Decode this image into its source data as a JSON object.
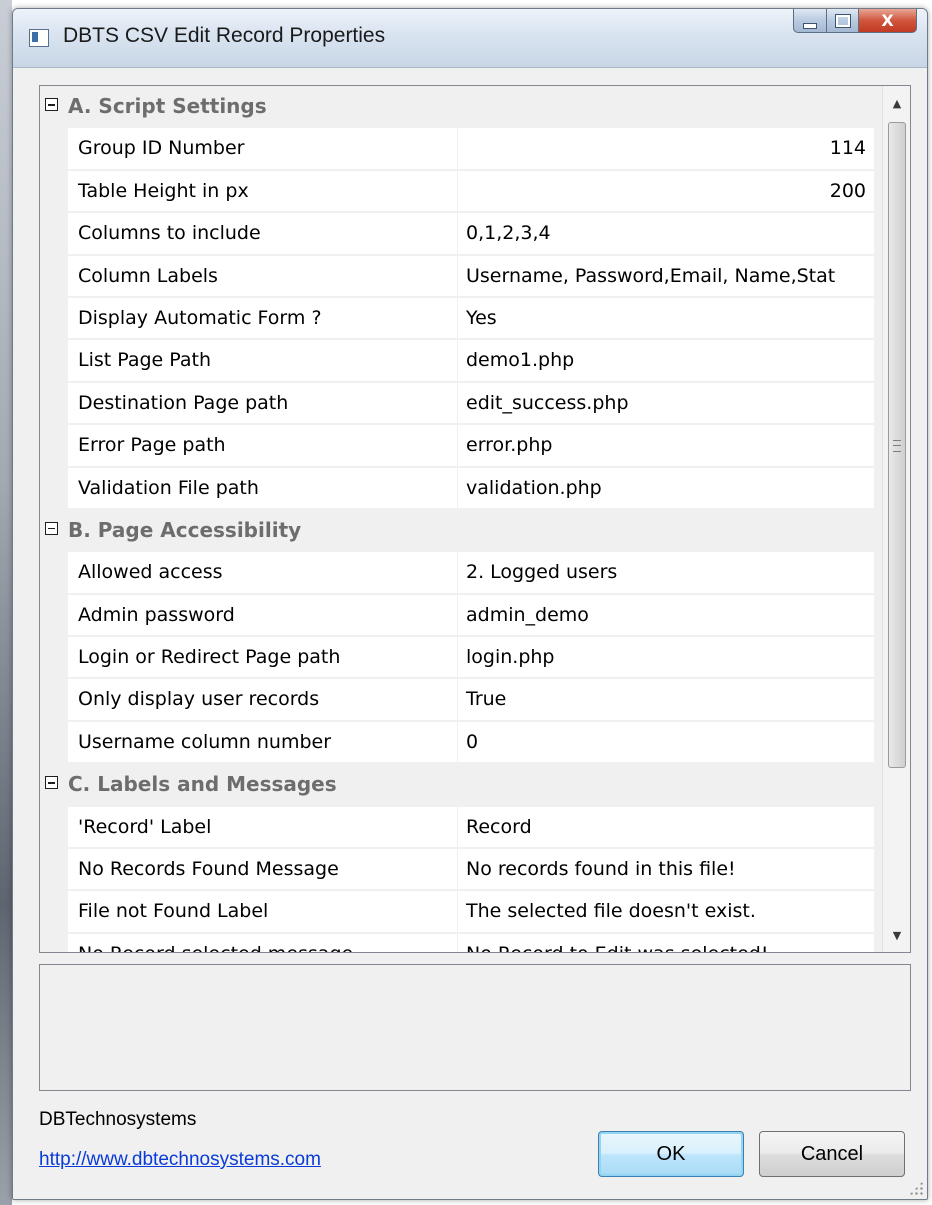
{
  "window": {
    "title": "DBTS CSV Edit Record Properties"
  },
  "icons": {
    "app": "app-window-icon",
    "minimize": "minimize-icon",
    "maximize": "maximize-icon",
    "close": "close-icon",
    "expander": "collapse-minus-icon",
    "scroll_up": "scroll-up-arrow-icon",
    "scroll_down": "scroll-down-arrow-icon"
  },
  "close_glyph": "X",
  "scroll_up_glyph": "▲",
  "scroll_down_glyph": "▼",
  "categories": [
    {
      "name": "A. Script Settings",
      "properties": [
        {
          "name": "Group ID Number",
          "value": "114",
          "align": "right"
        },
        {
          "name": "Table Height in px",
          "value": "200",
          "align": "right"
        },
        {
          "name": "Columns to include",
          "value": "0,1,2,3,4"
        },
        {
          "name": "Column Labels",
          "value": "Username, Password,Email, Name,Stat"
        },
        {
          "name": "Display Automatic Form ?",
          "value": "Yes"
        },
        {
          "name": "List Page Path",
          "value": "demo1.php"
        },
        {
          "name": "Destination Page path",
          "value": "edit_success.php"
        },
        {
          "name": "Error Page path",
          "value": "error.php"
        },
        {
          "name": "Validation File path",
          "value": "validation.php"
        }
      ]
    },
    {
      "name": "B. Page Accessibility",
      "properties": [
        {
          "name": "Allowed access",
          "value": "2. Logged users"
        },
        {
          "name": "Admin password",
          "value": "admin_demo"
        },
        {
          "name": "Login or Redirect Page path",
          "value": "login.php"
        },
        {
          "name": "Only display user records",
          "value": "True"
        },
        {
          "name": "Username column number",
          "value": "0"
        }
      ]
    },
    {
      "name": "C. Labels and Messages",
      "properties": [
        {
          "name": "'Record' Label",
          "value": "Record"
        },
        {
          "name": "No Records Found Message",
          "value": "No records found in this file!"
        },
        {
          "name": "File not Found Label",
          "value": "The selected file doesn't exist."
        },
        {
          "name": "No Record selected message",
          "value": "No Record to Edit was selected!"
        }
      ]
    }
  ],
  "description": {
    "title": "",
    "text": ""
  },
  "footer": {
    "company": "DBTechnosystems",
    "link": "http://www.dbtechnosystems.com",
    "ok_label": "OK",
    "cancel_label": "Cancel"
  }
}
